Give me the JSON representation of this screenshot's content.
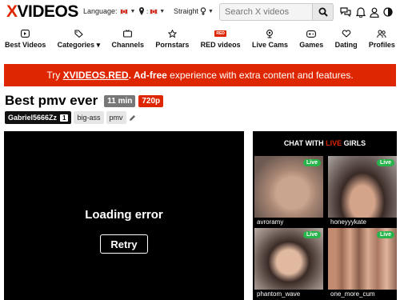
{
  "header": {
    "logo_x": "X",
    "logo_rest": "VIDEOS",
    "language_label": "Language:",
    "orientation_label": "Straight",
    "search_placeholder": "Search X videos"
  },
  "nav": {
    "items": [
      {
        "label": "Best Videos",
        "icon": "play-square-icon"
      },
      {
        "label": "Categories ▾",
        "icon": "tag-icon"
      },
      {
        "label": "Channels",
        "icon": "tv-icon"
      },
      {
        "label": "Pornstars",
        "icon": "star-icon"
      },
      {
        "label": "RED videos",
        "icon": "red-badge-icon",
        "badge": "RED"
      },
      {
        "label": "Live Cams",
        "icon": "webcam-icon"
      },
      {
        "label": "Games",
        "icon": "gamepad-icon"
      },
      {
        "label": "Dating",
        "icon": "hearts-icon"
      },
      {
        "label": "Profiles",
        "icon": "users-icon"
      }
    ]
  },
  "banner": {
    "pre": "Try ",
    "link": "XVIDEOS.RED",
    "mid": ". ",
    "bold": "Ad-free",
    "post": " experience with extra content and features."
  },
  "video": {
    "title": "Best pmv ever",
    "duration": "11 min",
    "quality": "720p",
    "uploader": "Gabriel5666Zz",
    "uploader_count": "1",
    "tags": [
      "big-ass",
      "pmv"
    ]
  },
  "player": {
    "error_text": "Loading error",
    "retry_label": "Retry"
  },
  "sidebar": {
    "title_pre": "CHAT WITH ",
    "title_live": "LIVE",
    "title_post": " GIRLS",
    "live_badge": "Live",
    "cams": [
      {
        "name": "avroramy"
      },
      {
        "name": "honeyyykate"
      },
      {
        "name": "phantom_wave"
      },
      {
        "name": "one_more_cum"
      }
    ]
  },
  "colors": {
    "accent": "#de2600",
    "live_green": "#28b34b"
  }
}
